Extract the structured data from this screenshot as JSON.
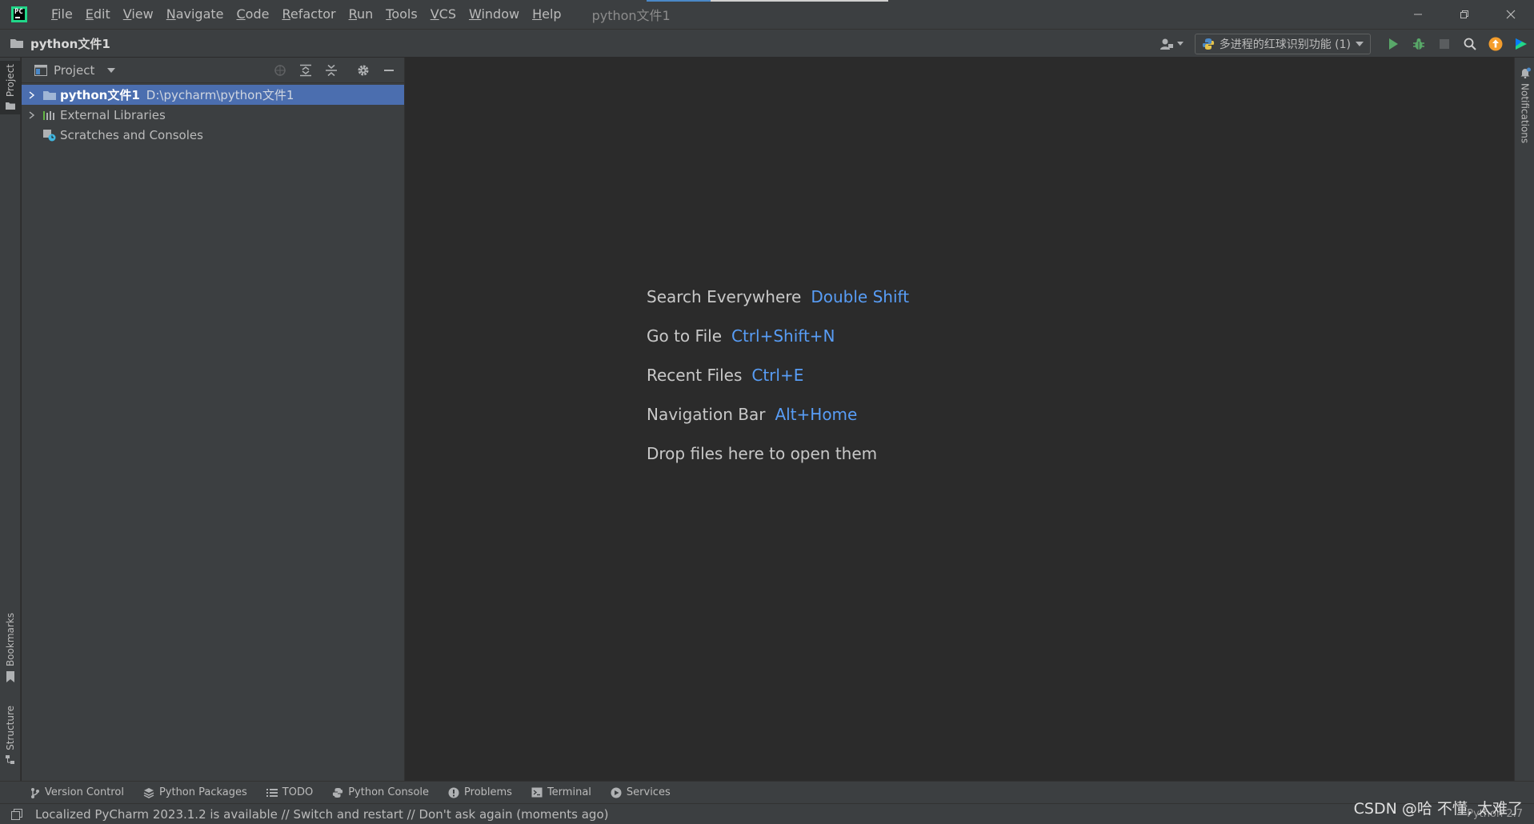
{
  "menubar": {
    "logo_text": "PC",
    "items": [
      "File",
      "Edit",
      "View",
      "Navigate",
      "Code",
      "Refactor",
      "Run",
      "Tools",
      "VCS",
      "Window",
      "Help"
    ],
    "window_title": "python文件1"
  },
  "navbar": {
    "project_name": "python文件1",
    "run_config": "多进程的红球识别功能 (1)"
  },
  "left_stripe": {
    "project_tab": "Project",
    "bookmarks_tab": "Bookmarks",
    "structure_tab": "Structure"
  },
  "project_panel": {
    "title": "Project",
    "tree": [
      {
        "label": "python文件1",
        "path": "D:\\pycharm\\python文件1"
      },
      {
        "label": "External Libraries"
      },
      {
        "label": "Scratches and Consoles"
      }
    ]
  },
  "editor": {
    "hints": [
      {
        "label": "Search Everywhere",
        "key": "Double Shift"
      },
      {
        "label": "Go to File",
        "key": "Ctrl+Shift+N"
      },
      {
        "label": "Recent Files",
        "key": "Ctrl+E"
      },
      {
        "label": "Navigation Bar",
        "key": "Alt+Home"
      },
      {
        "label": "Drop files here to open them",
        "key": ""
      }
    ]
  },
  "right_stripe": {
    "notifications_tab": "Notifications"
  },
  "bottom_tabs": [
    "Version Control",
    "Python Packages",
    "TODO",
    "Python Console",
    "Problems",
    "Terminal",
    "Services"
  ],
  "status": {
    "message": "Localized PyCharm 2023.1.2 is available // Switch and restart // Don't ask again (moments ago)",
    "interpreter": "Python 2.7"
  },
  "watermark": "CSDN @哈 不懂, 太难了",
  "colors": {
    "background": "#2b2b2b",
    "panel": "#3c3f41",
    "selection": "#4b6eaf",
    "shortcut": "#589df6",
    "run_green": "#59a869"
  }
}
